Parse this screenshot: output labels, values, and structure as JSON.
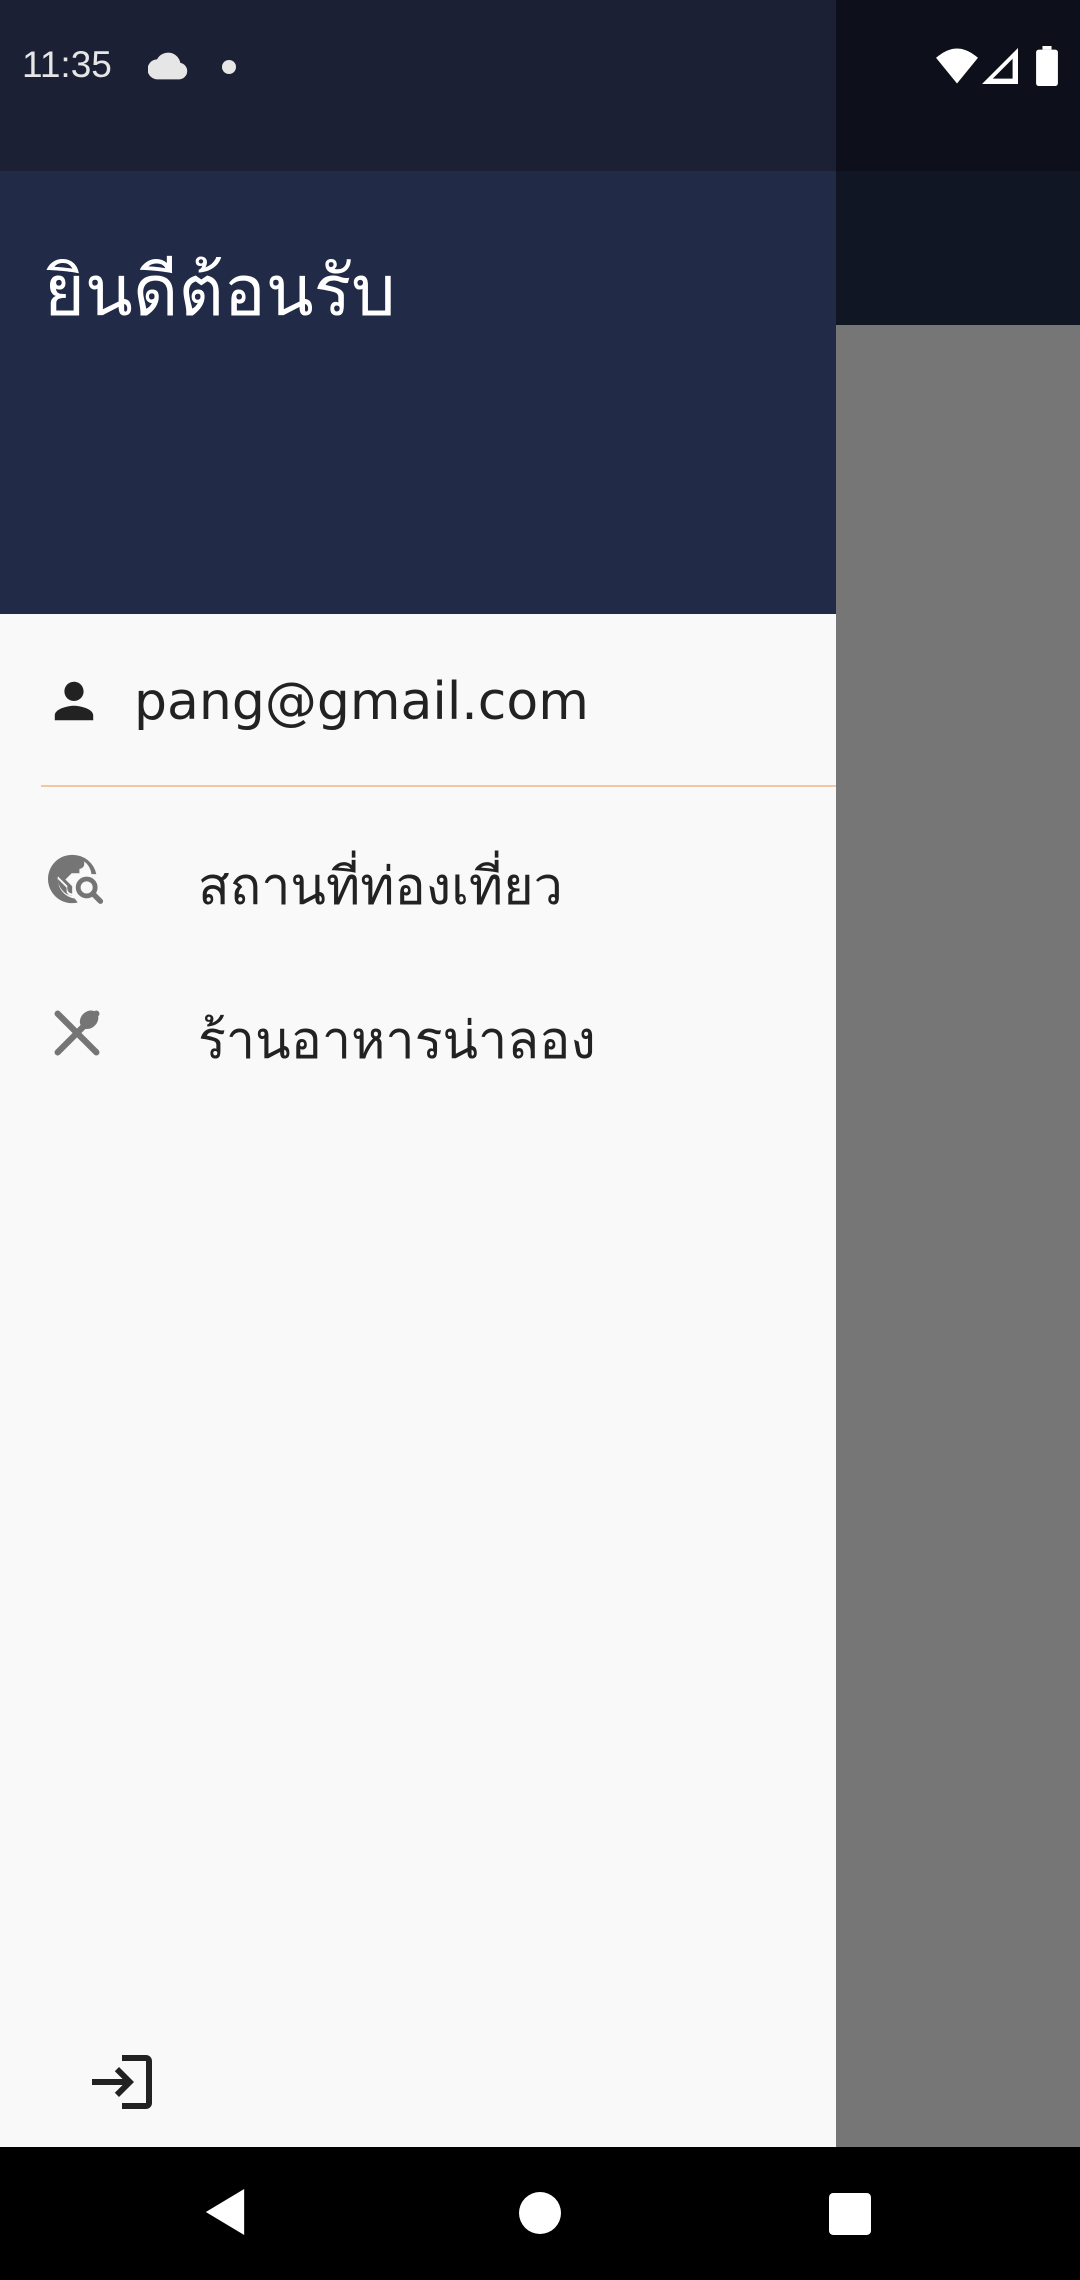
{
  "status_bar": {
    "time": "11:35",
    "icons": [
      "cloud-icon",
      "dot-icon",
      "wifi-icon",
      "signal-icon",
      "battery-icon"
    ]
  },
  "drawer": {
    "title": "ยินดีต้อนรับ",
    "user_email": "pang@gmail.com",
    "menu_items": [
      {
        "label": "สถานที่ท่องเที่ยว",
        "icon": "travel-explore-icon"
      },
      {
        "label": "ร้านอาหารน่าลอง",
        "icon": "restaurant-icon"
      }
    ],
    "logout_icon": "login-icon"
  },
  "navigation_bar": {
    "buttons": [
      "back-button",
      "home-button",
      "recents-button"
    ]
  },
  "colors": {
    "drawer_header": "#212a46",
    "drawer_statusbar": "#1c2034",
    "drawer_background": "#f9f9f9",
    "divider": "#f0c9a4",
    "scrim": "#767676"
  }
}
